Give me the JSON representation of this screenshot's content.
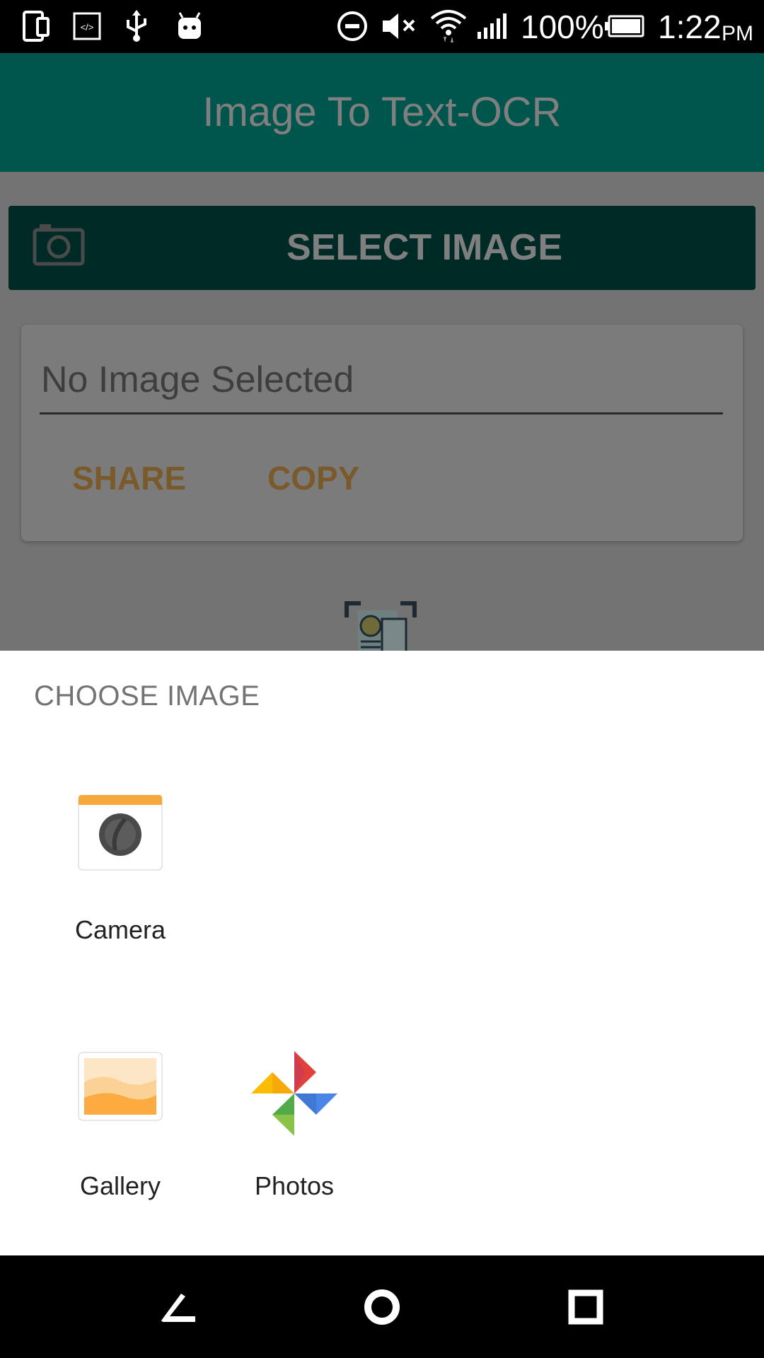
{
  "status_bar": {
    "icons": [
      "device-icon",
      "developer-icon",
      "usb-icon",
      "android-icon",
      "dnd-icon",
      "mute-icon",
      "wifi-icon",
      "signal-icon",
      "battery-icon"
    ],
    "battery_percent": "100%",
    "time": "1:22",
    "ampm": "PM"
  },
  "app": {
    "title": "Image To Text-OCR",
    "select_button_label": "SELECT IMAGE",
    "placeholder": "No Image Selected",
    "share_label": "SHARE",
    "copy_label": "COPY"
  },
  "chooser": {
    "title": "CHOOSE IMAGE",
    "apps": [
      {
        "label": "Camera",
        "icon": "camera-app-icon"
      },
      {
        "label": "Gallery",
        "icon": "gallery-app-icon"
      },
      {
        "label": "Photos",
        "icon": "photos-app-icon"
      }
    ]
  },
  "nav_bar": {
    "buttons": [
      "back-icon",
      "home-icon",
      "recents-icon"
    ]
  },
  "colors": {
    "appbar": "#00564d",
    "select_button": "#002a26",
    "accent": "#7a5a2a",
    "sheet": "#ffffff"
  }
}
